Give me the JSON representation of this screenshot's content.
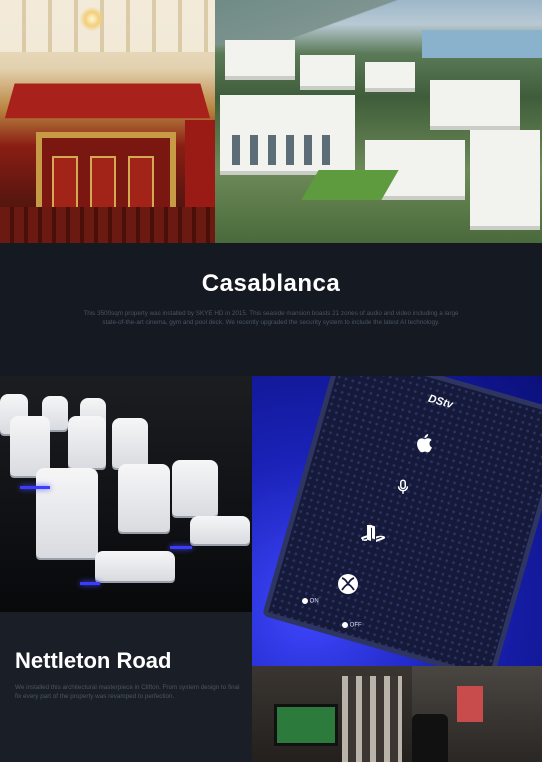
{
  "casablanca": {
    "title": "Casablanca",
    "body": "This 3500sqm property was installed by SKYE HD in 2015. This seaside mansion boasts 21 zones of audio and video including a large state-of-the-art cinema, gym and pool deck. We recently upgraded the security system to include the latest AI technology."
  },
  "nettleton": {
    "title": "Nettleton Road",
    "body": "We installed this architectural masterpiece in Clifton. From system design to final fix every part of the property was revamped to perfection."
  },
  "tablet": {
    "brand": "DStv",
    "switch_on": "ON",
    "switch_off": "OFF",
    "icons": [
      "apple-icon",
      "microphone-icon",
      "playstation-icon",
      "xbox-icon"
    ]
  },
  "colors": {
    "page_bg": "#141922",
    "title": "#ffffff",
    "body_text": "#4b5563",
    "accent_blue": "#1d24c9"
  }
}
